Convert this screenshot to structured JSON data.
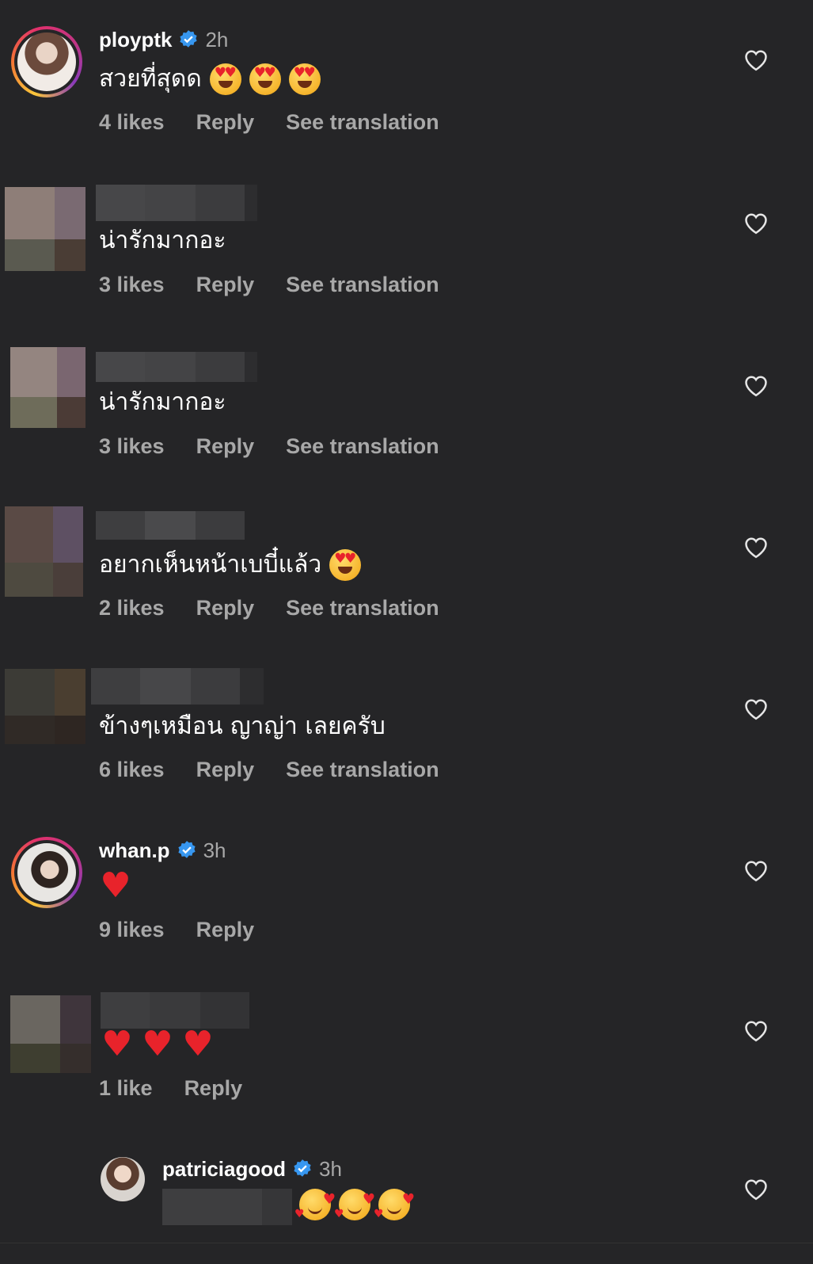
{
  "comments": [
    {
      "username": "ployptk",
      "verified": true,
      "time": "2h",
      "text": "สวยที่สุดด",
      "likes": "4 likes",
      "reply": "Reply",
      "translate": "See translation"
    },
    {
      "text": "น่ารักมากอะ",
      "likes": "3 likes",
      "reply": "Reply",
      "translate": "See translation"
    },
    {
      "text": "น่ารักมากอะ",
      "likes": "3 likes",
      "reply": "Reply",
      "translate": "See translation"
    },
    {
      "text": "อยากเห็นหน้าเบบี๋แล้ว",
      "likes": "2 likes",
      "reply": "Reply",
      "translate": "See translation"
    },
    {
      "text": "ข้างๆเหมือน ญาญ่า เลยครับ",
      "likes": "6 likes",
      "reply": "Reply",
      "translate": "See translation"
    },
    {
      "username": "whan.p",
      "verified": true,
      "time": "3h",
      "likes": "9 likes",
      "reply": "Reply"
    },
    {
      "likes": "1 like",
      "reply": "Reply"
    },
    {
      "username": "patriciagood",
      "verified": true,
      "time": "3h"
    }
  ],
  "icons": {
    "like": "heart-outline-icon",
    "verified": "verified-badge-icon",
    "emoji_love": "heart-eyes-emoji",
    "emoji_heart": "red-heart-emoji",
    "emoji_smile": "smiling-face-with-hearts-emoji"
  },
  "colors": {
    "background": "#252527",
    "text": "#ffffff",
    "secondary": "#a8a8a8",
    "verified": "#3797f0"
  }
}
